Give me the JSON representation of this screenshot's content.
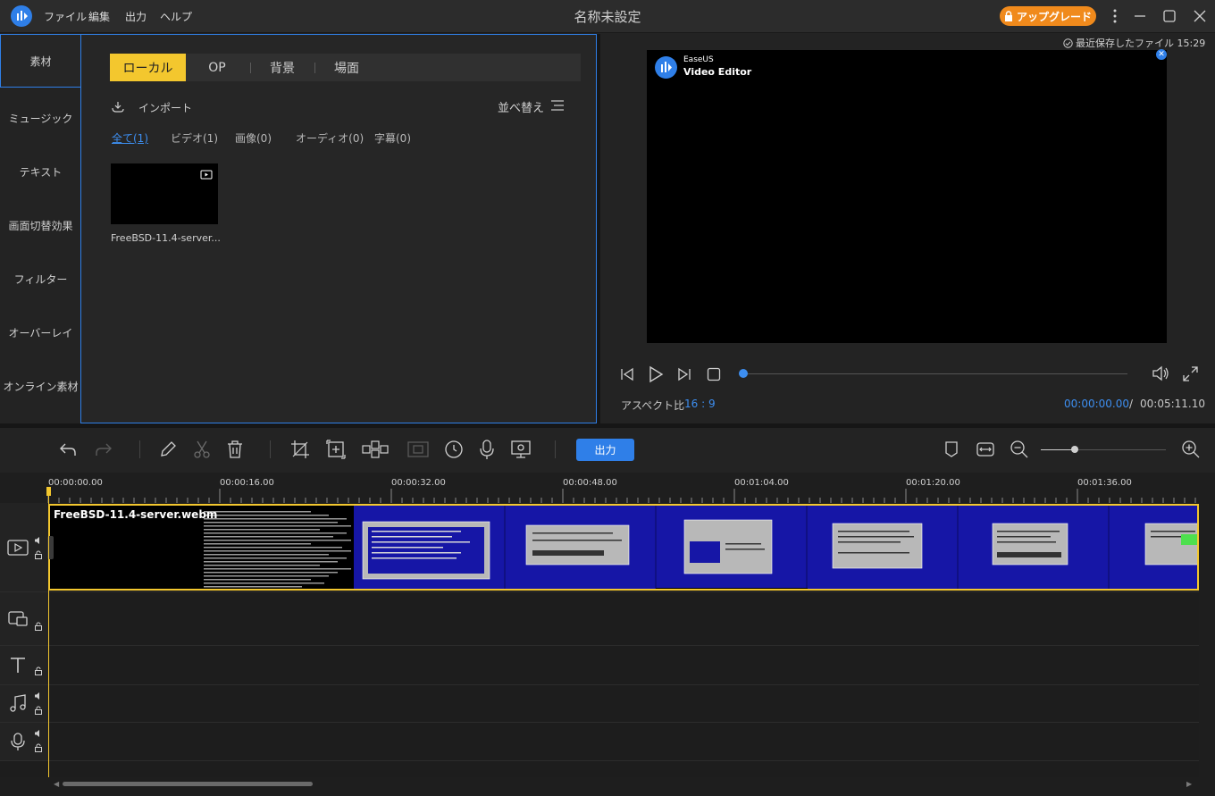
{
  "titlebar": {
    "menus": [
      "ファイル",
      "編集",
      "出力",
      "ヘルプ"
    ],
    "title": "名称未設定",
    "upgrade_label": "アップグレード"
  },
  "left_nav": {
    "items": [
      "素材",
      "ミュージック",
      "テキスト",
      "画面切替効果",
      "フィルター",
      "オーバーレイ",
      "オンライン素材"
    ],
    "active_index": 0
  },
  "media": {
    "tabs": [
      "ローカル",
      "OP",
      "背景",
      "場面"
    ],
    "active_tab": 0,
    "import_label": "インポート",
    "sort_label": "並べ替え",
    "filters": [
      "全て(1)",
      "ビデオ(1)",
      "画像(0)",
      "オーディオ(0)",
      "字幕(0)"
    ],
    "items": [
      {
        "name": "FreeBSD-11.4-server...."
      }
    ]
  },
  "preview": {
    "saved_label": "最近保存したファイル 15:29",
    "watermark_brand": "EaseUS",
    "watermark_product": "Video Editor",
    "aspect_label": "アスペクト比",
    "aspect_value": "16 : 9",
    "time_current": "00:00:00.00",
    "time_separator": "/",
    "time_total": "00:05:11.10",
    "progress": 0
  },
  "toolbar": {
    "export_label": "出力",
    "zoom_level": 0.27
  },
  "timeline": {
    "ticks": [
      "00:00:00.00",
      "00:00:16.00",
      "00:00:32.00",
      "00:00:48.00",
      "00:01:04.00",
      "00:01:20.00",
      "00:01:36.00"
    ],
    "clip_name": "FreeBSD-11.4-server.webm"
  },
  "colors": {
    "accent": "#2f7fe8",
    "highlight": "#f3c72e",
    "upgrade": "#f08a1c"
  }
}
